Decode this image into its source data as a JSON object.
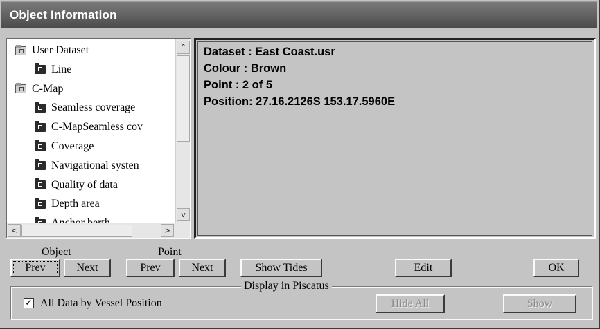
{
  "window": {
    "title": "Object Information"
  },
  "tree": {
    "items": [
      {
        "label": "User Dataset",
        "indent": 0,
        "icon": "folder-icon"
      },
      {
        "label": "Line",
        "indent": 1,
        "icon": "folder-open-icon"
      },
      {
        "label": "C-Map",
        "indent": 0,
        "icon": "folder-icon"
      },
      {
        "label": "Seamless coverage",
        "indent": 1,
        "icon": "folder-icon"
      },
      {
        "label": "C-MapSeamless cov",
        "indent": 1,
        "icon": "folder-icon"
      },
      {
        "label": "Coverage",
        "indent": 1,
        "icon": "folder-icon"
      },
      {
        "label": "Navigational systen",
        "indent": 1,
        "icon": "folder-icon"
      },
      {
        "label": "Quality of data",
        "indent": 1,
        "icon": "folder-icon"
      },
      {
        "label": "Depth area",
        "indent": 1,
        "icon": "folder-icon"
      },
      {
        "label": "Anchor berth",
        "indent": 1,
        "icon": "folder-icon"
      }
    ],
    "scroll_up_glyph": "^",
    "scroll_down_glyph": "v",
    "scroll_left_glyph": "<",
    "scroll_right_glyph": ">"
  },
  "info": {
    "dataset": "Dataset :  East Coast.usr",
    "colour": "Colour :  Brown",
    "point": "Point : 2 of 5",
    "position": "Position: 27.16.2126S 153.17.5960E"
  },
  "controls": {
    "object_label": "Object",
    "point_label": "Point",
    "object_prev": "Prev",
    "object_next": "Next",
    "point_prev": "Prev",
    "point_next": "Next",
    "show_tides": "Show Tides",
    "edit": "Edit",
    "ok": "OK"
  },
  "display_group": {
    "label": "Display in Piscatus",
    "checkbox_label": "All Data by Vessel Position",
    "checkbox_checked": true,
    "checkbox_mark": "✓",
    "hide_all": "Hide All",
    "show": "Show"
  }
}
